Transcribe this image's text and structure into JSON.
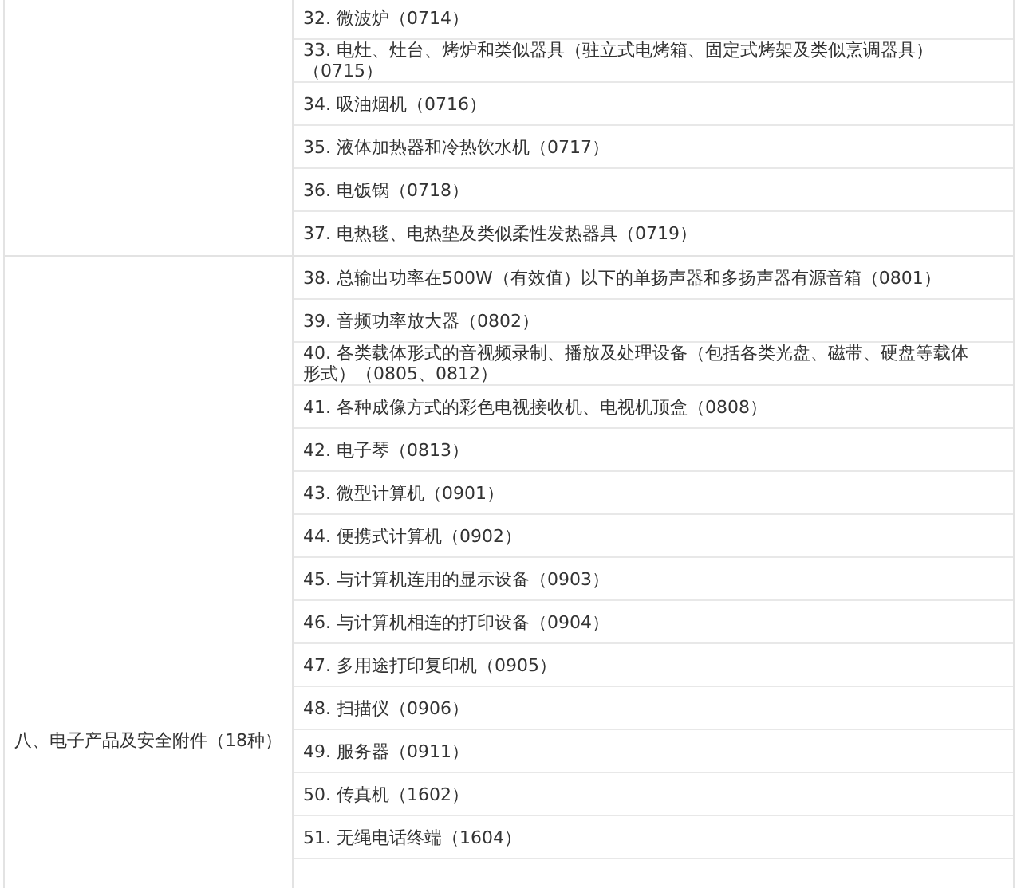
{
  "groups": [
    {
      "items": [
        "32. 微波炉（0714）",
        "33. 电灶、灶台、烤炉和类似器具（驻立式电烤箱、固定式烤架及类似烹调器具）（0715）",
        "34. 吸油烟机（0716）",
        "35. 液体加热器和冷热饮水机（0717）",
        "36. 电饭锅（0718）",
        "37. 电热毯、电热垫及类似柔性发热器具（0719）"
      ]
    },
    {
      "label": "八、电子产品及安全附件（18种）",
      "items": [
        "38. 总输出功率在500W（有效值）以下的单扬声器和多扬声器有源音箱（0801）",
        "39. 音频功率放大器（0802）",
        "40. 各类载体形式的音视频录制、播放及处理设备（包括各类光盘、磁带、硬盘等载体形式）（0805、0812）",
        "41. 各种成像方式的彩色电视接收机、电视机顶盒（0808）",
        "42. 电子琴（0813）",
        "43. 微型计算机（0901）",
        "44. 便携式计算机（0902）",
        "45. 与计算机连用的显示设备（0903）",
        "46. 与计算机相连的打印设备（0904）",
        "47. 多用途打印复印机（0905）",
        "48. 扫描仪（0906）",
        "49. 服务器（0911）",
        "50. 传真机（1602）",
        "51. 无绳电话终端（1604）"
      ]
    }
  ]
}
